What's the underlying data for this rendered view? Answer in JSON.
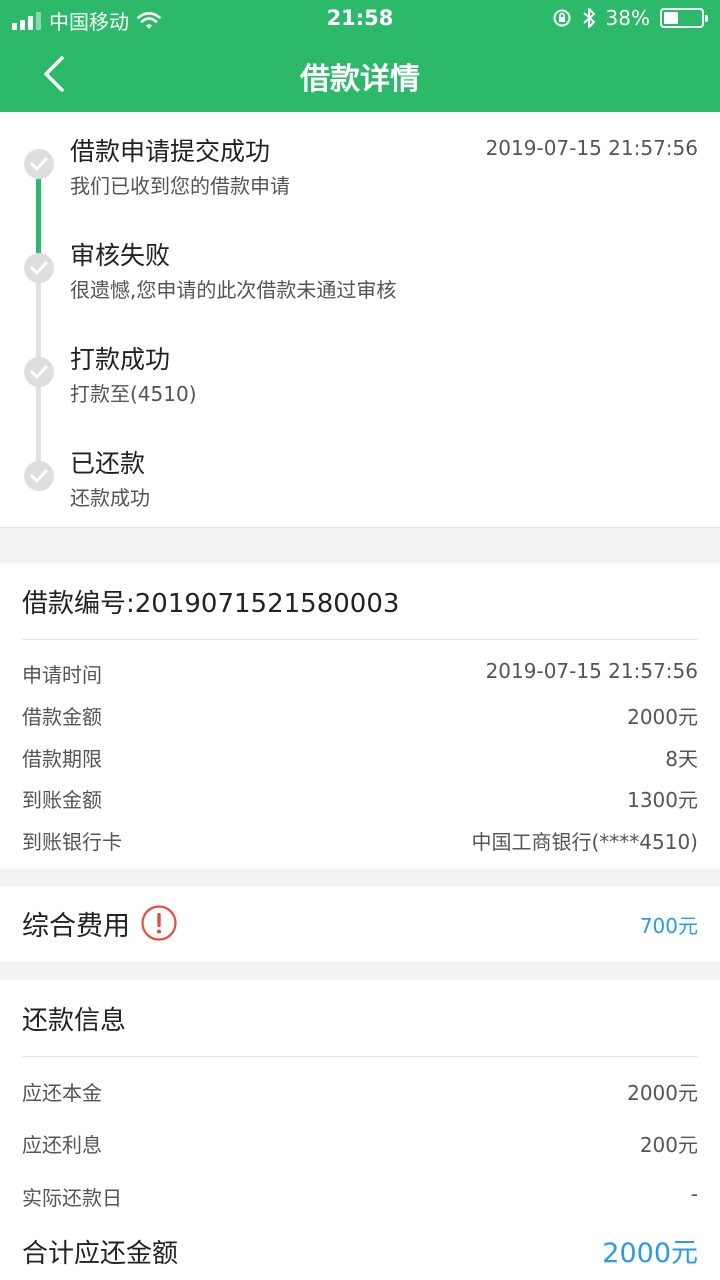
{
  "status_bar": {
    "carrier": "中国移动",
    "time": "21:58",
    "battery_percent": "38%",
    "battery_level": 0.38,
    "icons": [
      "signal-icon",
      "wifi-icon",
      "rotation-lock-icon",
      "bluetooth-icon",
      "battery-icon"
    ]
  },
  "nav": {
    "title": "借款详情",
    "back_icon": "chevron-left-icon"
  },
  "colors": {
    "brand_green": "#2db96a",
    "accent_blue": "#2a9be8",
    "warning_red": "#e74c3c"
  },
  "timeline": {
    "steps": [
      {
        "title": "借款申请提交成功",
        "desc": "我们已收到您的借款申请",
        "time": "2019-07-15 21:57:56"
      },
      {
        "title": "审核失败",
        "desc": "很遗憾,您申请的此次借款未通过审核",
        "time": ""
      },
      {
        "title": "打款成功",
        "desc": "打款至(4510)",
        "time": ""
      },
      {
        "title": "已还款",
        "desc": "还款成功",
        "time": ""
      }
    ]
  },
  "loan": {
    "number_label": "借款编号:2019071521580003",
    "rows": [
      {
        "label": "申请时间",
        "value": "2019-07-15 21:57:56"
      },
      {
        "label": "借款金额",
        "value": "2000元"
      },
      {
        "label": "借款期限",
        "value": "8天"
      },
      {
        "label": "到账金额",
        "value": "1300元"
      },
      {
        "label": "到账银行卡",
        "value": "中国工商银行(****4510)"
      }
    ]
  },
  "fee": {
    "label": "综合费用",
    "value": "700元",
    "icon": "info-alert-icon"
  },
  "repay": {
    "title": "还款信息",
    "rows": [
      {
        "label": "应还本金",
        "value": "2000元"
      },
      {
        "label": "应还利息",
        "value": "200元"
      },
      {
        "label": "实际还款日",
        "value": "-"
      }
    ],
    "total_label": "合计应还金额",
    "total_value": "2000元"
  }
}
